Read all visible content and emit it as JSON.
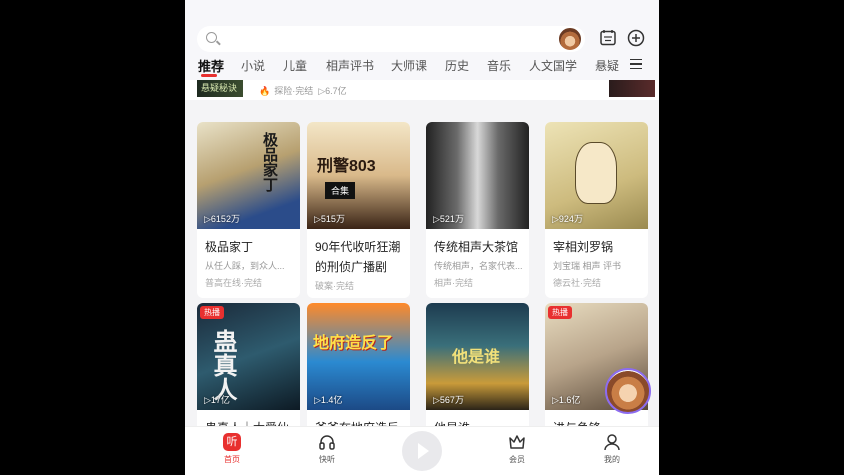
{
  "header": {
    "search_placeholder": "",
    "tabs": [
      "推荐",
      "小说",
      "儿童",
      "相声评书",
      "大师课",
      "历史",
      "音乐",
      "人文国学",
      "悬疑"
    ]
  },
  "partial_row": {
    "left_thumb_text": "悬疑秘诀",
    "meta": "探险·完结",
    "plays": "▷6.7亿"
  },
  "cards": [
    {
      "title": "极品家丁",
      "desc": "从任人踩，到众人...",
      "tags": "普高在线·完结",
      "plays": "▷6152万",
      "hot": "",
      "cover_text": "极品家丁"
    },
    {
      "title": "90年代收听狂潮的刑侦广播剧",
      "desc": "",
      "tags": "破案·完结",
      "plays": "▷515万",
      "hot": "",
      "cover_text": "刑警803"
    },
    {
      "title": "传统相声大茶馆",
      "desc": "传统相声，名家代表...",
      "tags": "相声·完结",
      "plays": "▷521万",
      "hot": "",
      "cover_text": ""
    },
    {
      "title": "宰相刘罗锅",
      "desc": "刘宝瑞 相声 评书",
      "tags": "德云社·完结",
      "plays": "▷924万",
      "hot": "",
      "cover_text": ""
    },
    {
      "title": "蛊真人｜太爱仙",
      "desc": "",
      "tags": "",
      "plays": "▷17亿",
      "hot": "热播",
      "cover_text": "蛊真人"
    },
    {
      "title": "爷爷在地府造反了",
      "desc": "",
      "tags": "",
      "plays": "▷1.4亿",
      "hot": "",
      "cover_text": "地府造反了"
    },
    {
      "title": "他是谁",
      "desc": "",
      "tags": "",
      "plays": "▷567万",
      "hot": "",
      "cover_text": "他是谁"
    },
    {
      "title": "进与争锋",
      "desc": "",
      "tags": "",
      "plays": "▷1.6亿",
      "hot": "热播",
      "cover_text": ""
    }
  ],
  "nav": {
    "home": "首页",
    "quick": "快听",
    "member": "会员",
    "mine": "我的",
    "home_glyph": "听"
  },
  "colors": {
    "accent": "#e8302f"
  }
}
